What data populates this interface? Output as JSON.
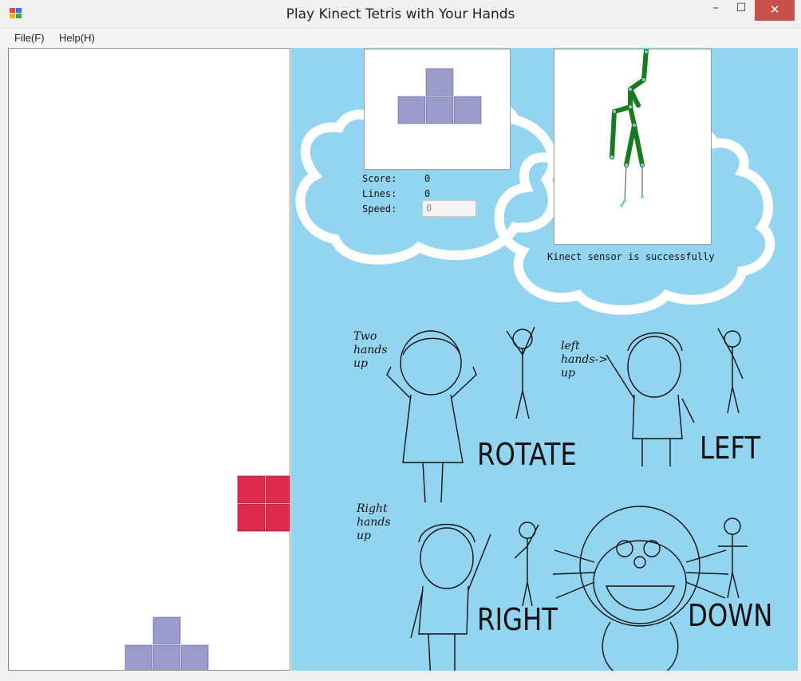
{
  "window": {
    "title": "Play Kinect Tetris with Your Hands",
    "minimize_glyph": "–",
    "maximize_glyph": "☐",
    "close_glyph": "✕"
  },
  "menu": {
    "items": [
      {
        "label": "File(F)"
      },
      {
        "label": "Help(H)"
      }
    ]
  },
  "stats": {
    "score_label": "Score:",
    "score_value": "0",
    "lines_label": "Lines:",
    "lines_value": "0",
    "speed_label": "Speed:",
    "speed_value": "0"
  },
  "kinect": {
    "status": "Kinect sensor is successfully"
  },
  "instructions": {
    "rotate": {
      "hint_lines": [
        "Two",
        "hands",
        "up"
      ],
      "label": "ROTATE"
    },
    "left": {
      "hint_lines": [
        "left",
        "hands->",
        "up"
      ],
      "label": "LEFT"
    },
    "right": {
      "hint_lines": [
        "Right",
        "hands",
        "up"
      ],
      "label": "RIGHT"
    },
    "down": {
      "label": "DOWN"
    }
  },
  "colors": {
    "panel_bg": "#93d4f0",
    "piece_purple": "#9b9bcc",
    "piece_red": "#dc2b4b",
    "skeleton_green": "#1a7a22"
  },
  "icons": {
    "app": "app-icon",
    "dropdown": "chevron-down-icon"
  }
}
